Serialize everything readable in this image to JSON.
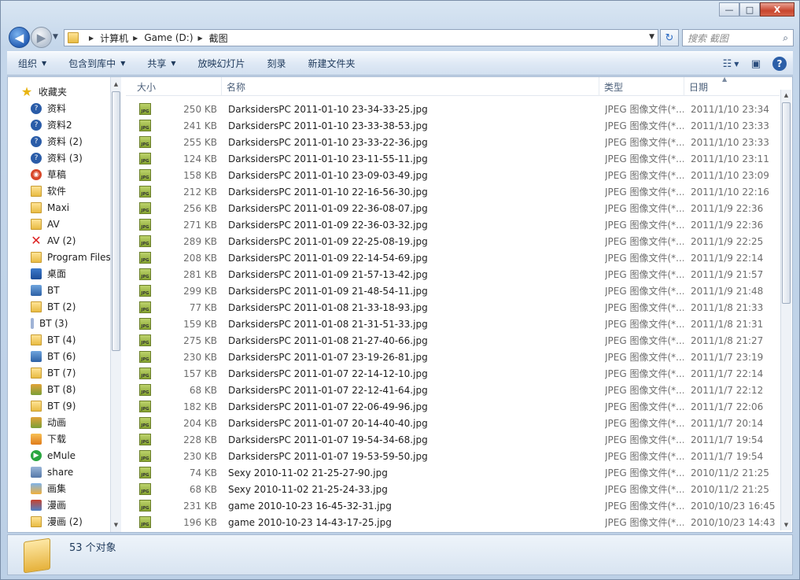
{
  "window": {
    "controls": [
      "—",
      "□",
      "X"
    ]
  },
  "address": {
    "breadcrumbs": [
      "计算机",
      "Game (D:)",
      "截图"
    ]
  },
  "search": {
    "placeholder": "搜索 截图"
  },
  "toolbar": {
    "organize": "组织",
    "include_in_library": "包含到库中",
    "share": "共享",
    "slideshow": "放映幻灯片",
    "burn": "刻录",
    "new_folder": "新建文件夹"
  },
  "sidebar": {
    "items": [
      {
        "label": "收藏夹",
        "icon": "star-icon"
      },
      {
        "label": "资料",
        "icon": "help-icon"
      },
      {
        "label": "资料2",
        "icon": "help-icon"
      },
      {
        "label": "资料 (2)",
        "icon": "help-icon"
      },
      {
        "label": "资料 (3)",
        "icon": "help-icon"
      },
      {
        "label": "草稿",
        "icon": "app-icon"
      },
      {
        "label": "软件",
        "icon": "folder-icon"
      },
      {
        "label": "Maxi",
        "icon": "folder-icon"
      },
      {
        "label": "AV",
        "icon": "folder-icon"
      },
      {
        "label": "AV (2)",
        "icon": "x-icon"
      },
      {
        "label": "Program Files (",
        "icon": "folder-icon"
      },
      {
        "label": "桌面",
        "icon": "desktop-icon"
      },
      {
        "label": "BT",
        "icon": "network-icon"
      },
      {
        "label": "BT (2)",
        "icon": "folder-icon"
      },
      {
        "label": "BT (3)",
        "icon": "bar-icon"
      },
      {
        "label": "BT (4)",
        "icon": "folder-icon"
      },
      {
        "label": "BT (6)",
        "icon": "network-icon"
      },
      {
        "label": "BT (7)",
        "icon": "folder-icon"
      },
      {
        "label": "BT (8)",
        "icon": "image-icon"
      },
      {
        "label": "BT (9)",
        "icon": "folder-icon"
      },
      {
        "label": "动画",
        "icon": "image-icon"
      },
      {
        "label": "下载",
        "icon": "download-icon"
      },
      {
        "label": "eMule",
        "icon": "emule-icon"
      },
      {
        "label": "share",
        "icon": "share-icon"
      },
      {
        "label": "画集",
        "icon": "picture-icon"
      },
      {
        "label": "漫画",
        "icon": "book-icon"
      },
      {
        "label": "漫画 (2)",
        "icon": "folder-icon"
      }
    ]
  },
  "columns": {
    "size": "大小",
    "name": "名称",
    "type": "类型",
    "date": "日期"
  },
  "files": [
    {
      "size": "250 KB",
      "name": "DarksidersPC 2011-01-10 23-34-33-25.jpg",
      "type": "JPEG 图像文件(*...",
      "date": "2011/1/10 23:34"
    },
    {
      "size": "241 KB",
      "name": "DarksidersPC 2011-01-10 23-33-38-53.jpg",
      "type": "JPEG 图像文件(*...",
      "date": "2011/1/10 23:33"
    },
    {
      "size": "255 KB",
      "name": "DarksidersPC 2011-01-10 23-33-22-36.jpg",
      "type": "JPEG 图像文件(*...",
      "date": "2011/1/10 23:33"
    },
    {
      "size": "124 KB",
      "name": "DarksidersPC 2011-01-10 23-11-55-11.jpg",
      "type": "JPEG 图像文件(*...",
      "date": "2011/1/10 23:11"
    },
    {
      "size": "158 KB",
      "name": "DarksidersPC 2011-01-10 23-09-03-49.jpg",
      "type": "JPEG 图像文件(*...",
      "date": "2011/1/10 23:09"
    },
    {
      "size": "212 KB",
      "name": "DarksidersPC 2011-01-10 22-16-56-30.jpg",
      "type": "JPEG 图像文件(*...",
      "date": "2011/1/10 22:16"
    },
    {
      "size": "256 KB",
      "name": "DarksidersPC 2011-01-09 22-36-08-07.jpg",
      "type": "JPEG 图像文件(*...",
      "date": "2011/1/9 22:36"
    },
    {
      "size": "271 KB",
      "name": "DarksidersPC 2011-01-09 22-36-03-32.jpg",
      "type": "JPEG 图像文件(*...",
      "date": "2011/1/9 22:36"
    },
    {
      "size": "289 KB",
      "name": "DarksidersPC 2011-01-09 22-25-08-19.jpg",
      "type": "JPEG 图像文件(*...",
      "date": "2011/1/9 22:25"
    },
    {
      "size": "208 KB",
      "name": "DarksidersPC 2011-01-09 22-14-54-69.jpg",
      "type": "JPEG 图像文件(*...",
      "date": "2011/1/9 22:14"
    },
    {
      "size": "281 KB",
      "name": "DarksidersPC 2011-01-09 21-57-13-42.jpg",
      "type": "JPEG 图像文件(*...",
      "date": "2011/1/9 21:57"
    },
    {
      "size": "299 KB",
      "name": "DarksidersPC 2011-01-09 21-48-54-11.jpg",
      "type": "JPEG 图像文件(*...",
      "date": "2011/1/9 21:48"
    },
    {
      "size": "77 KB",
      "name": "DarksidersPC 2011-01-08 21-33-18-93.jpg",
      "type": "JPEG 图像文件(*...",
      "date": "2011/1/8 21:33"
    },
    {
      "size": "159 KB",
      "name": "DarksidersPC 2011-01-08 21-31-51-33.jpg",
      "type": "JPEG 图像文件(*...",
      "date": "2011/1/8 21:31"
    },
    {
      "size": "275 KB",
      "name": "DarksidersPC 2011-01-08 21-27-40-66.jpg",
      "type": "JPEG 图像文件(*...",
      "date": "2011/1/8 21:27"
    },
    {
      "size": "230 KB",
      "name": "DarksidersPC 2011-01-07 23-19-26-81.jpg",
      "type": "JPEG 图像文件(*...",
      "date": "2011/1/7 23:19"
    },
    {
      "size": "157 KB",
      "name": "DarksidersPC 2011-01-07 22-14-12-10.jpg",
      "type": "JPEG 图像文件(*...",
      "date": "2011/1/7 22:14"
    },
    {
      "size": "68 KB",
      "name": "DarksidersPC 2011-01-07 22-12-41-64.jpg",
      "type": "JPEG 图像文件(*...",
      "date": "2011/1/7 22:12"
    },
    {
      "size": "182 KB",
      "name": "DarksidersPC 2011-01-07 22-06-49-96.jpg",
      "type": "JPEG 图像文件(*...",
      "date": "2011/1/7 22:06"
    },
    {
      "size": "204 KB",
      "name": "DarksidersPC 2011-01-07 20-14-40-40.jpg",
      "type": "JPEG 图像文件(*...",
      "date": "2011/1/7 20:14"
    },
    {
      "size": "228 KB",
      "name": "DarksidersPC 2011-01-07 19-54-34-68.jpg",
      "type": "JPEG 图像文件(*...",
      "date": "2011/1/7 19:54"
    },
    {
      "size": "230 KB",
      "name": "DarksidersPC 2011-01-07 19-53-59-50.jpg",
      "type": "JPEG 图像文件(*...",
      "date": "2011/1/7 19:54"
    },
    {
      "size": "74 KB",
      "name": "Sexy 2010-11-02 21-25-27-90.jpg",
      "type": "JPEG 图像文件(*...",
      "date": "2010/11/2 21:25"
    },
    {
      "size": "68 KB",
      "name": "Sexy 2010-11-02 21-25-24-33.jpg",
      "type": "JPEG 图像文件(*...",
      "date": "2010/11/2 21:25"
    },
    {
      "size": "231 KB",
      "name": "game 2010-10-23 16-45-32-31.jpg",
      "type": "JPEG 图像文件(*...",
      "date": "2010/10/23 16:45"
    },
    {
      "size": "196 KB",
      "name": "game 2010-10-23 14-43-17-25.jpg",
      "type": "JPEG 图像文件(*...",
      "date": "2010/10/23 14:43"
    }
  ],
  "status": {
    "count_text": "53 个对象"
  }
}
